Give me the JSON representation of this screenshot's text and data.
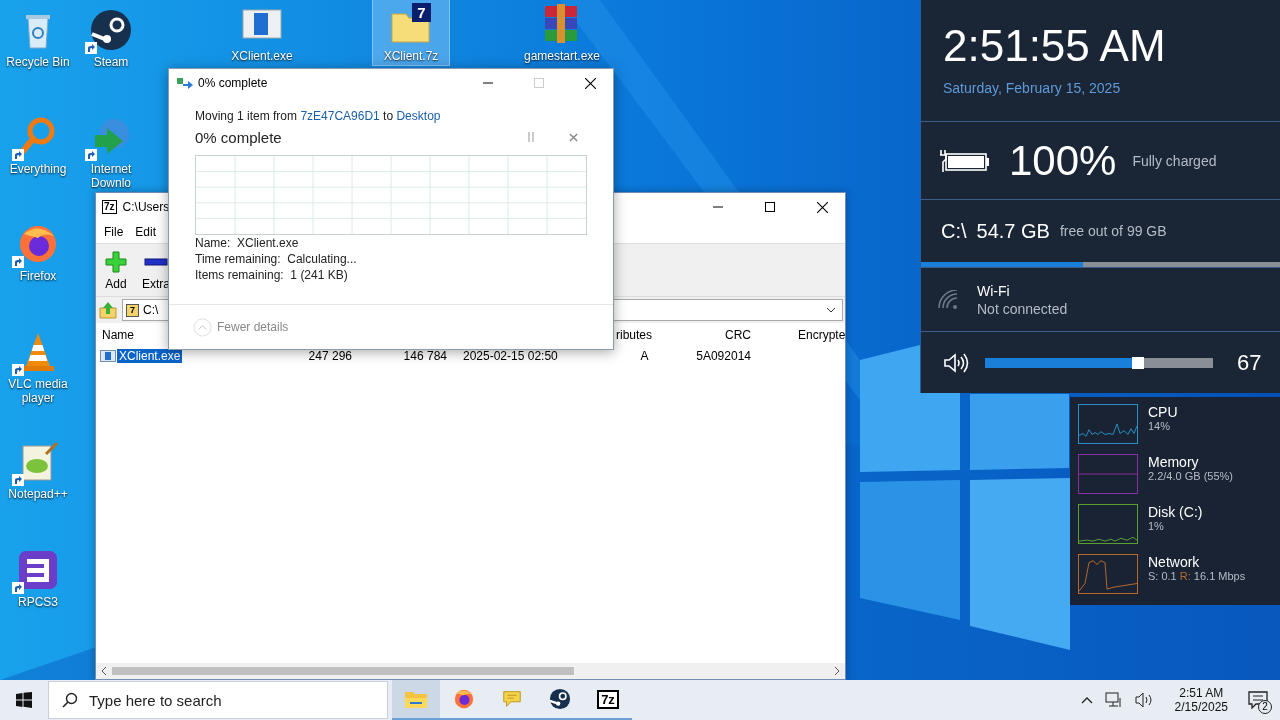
{
  "desktop_icons": [
    {
      "label": "Recycle Bin",
      "kind": "recycle-bin",
      "shortcut": false,
      "selected": false
    },
    {
      "label": "Steam",
      "kind": "steam",
      "shortcut": true,
      "selected": false
    },
    {
      "label": "Everything",
      "kind": "everything",
      "shortcut": true,
      "selected": false
    },
    {
      "label": "Internet Downlo",
      "kind": "download-manager",
      "shortcut": true,
      "selected": false
    },
    {
      "label": "Firefox",
      "kind": "firefox",
      "shortcut": true,
      "selected": false
    },
    {
      "label": "VLC media player",
      "kind": "vlc",
      "shortcut": true,
      "selected": false
    },
    {
      "label": "Notepad++",
      "kind": "notepad",
      "shortcut": true,
      "selected": false
    },
    {
      "label": "RPCS3",
      "kind": "rpcs3",
      "shortcut": true,
      "selected": false
    },
    {
      "label": "XClient.exe",
      "kind": "exe",
      "shortcut": false,
      "selected": false
    },
    {
      "label": "XClient.7z",
      "kind": "archive-7z",
      "glyph": "7",
      "shortcut": false,
      "selected": true
    },
    {
      "label": "gamestart.exe",
      "kind": "winrar",
      "shortcut": false,
      "selected": false
    }
  ],
  "archive_window": {
    "title": "C:\\Users",
    "title_glyph": "7z",
    "menu": [
      "File",
      "Edit"
    ],
    "toolbar": [
      {
        "label": "Add",
        "kind": "add"
      },
      {
        "label": "Extra",
        "kind": "extract"
      }
    ],
    "address": {
      "glyph": "7",
      "value": "C:\\"
    },
    "columns": [
      "Name",
      "",
      "",
      "",
      "ributes",
      "CRC",
      "Encrypte"
    ],
    "rows": [
      {
        "selected": true,
        "cells": [
          "XClient.exe",
          "247 296",
          "146 784",
          "2025-02-15 02:50",
          "A",
          "5A092014"
        ]
      }
    ]
  },
  "copy_dialog": {
    "title": "0% complete",
    "summary": {
      "prefix": "Moving 1 item from",
      "source": "7zE47CA96D1",
      "middle": "to",
      "destination": "Desktop"
    },
    "status": "0% complete",
    "level": 0,
    "details": [
      {
        "label": "Name:",
        "value": "XClient.exe"
      },
      {
        "label": "Time remaining:",
        "value": "Calculating..."
      },
      {
        "label": "Items remaining:",
        "value": "1 (241 KB)"
      }
    ],
    "toggle": "Fewer details"
  },
  "status_panel": {
    "time": "2:51:55 AM",
    "date": "Saturday, February 15, 2025",
    "battery": {
      "percent": "100%",
      "status": "Fully charged"
    },
    "disk": {
      "drive": "C:\\",
      "free": "54.7 GB",
      "caption": "free out of 99 GB",
      "level": 0.45
    },
    "wifi": {
      "name": "Wi-Fi",
      "status": "Not connected"
    },
    "volume": {
      "level": 0.67,
      "reading": "67"
    }
  },
  "performance": [
    {
      "name": "CPU",
      "kind": "usage",
      "detail": "14%",
      "color": "#2a8fc6"
    },
    {
      "name": "Memory",
      "kind": "usage",
      "detail": "2.2/4.0 GB (55%)",
      "color": "#8a2ea3"
    },
    {
      "name": "Disk (C:)",
      "kind": "usage",
      "detail": "1%",
      "color": "#5aa02c"
    },
    {
      "name": "Network",
      "kind": "throughput",
      "send": "S: 0.1",
      "receive_label": "R:",
      "receive": "16.1 Mbps",
      "color": "#b8692a"
    }
  ],
  "taskbar": {
    "search_placeholder": "Type here to search",
    "apps": [
      {
        "kind": "explorer",
        "selected": true,
        "running": true
      },
      {
        "kind": "firefox",
        "selected": false,
        "running": true
      },
      {
        "kind": "chat",
        "selected": false,
        "running": true
      },
      {
        "kind": "steam",
        "selected": false,
        "running": true
      },
      {
        "kind": "sevenzip",
        "glyph": "7z",
        "selected": false,
        "running": true
      }
    ],
    "tray": {
      "time": "2:51 AM",
      "date": "2/15/2025",
      "notifications": "2"
    }
  }
}
